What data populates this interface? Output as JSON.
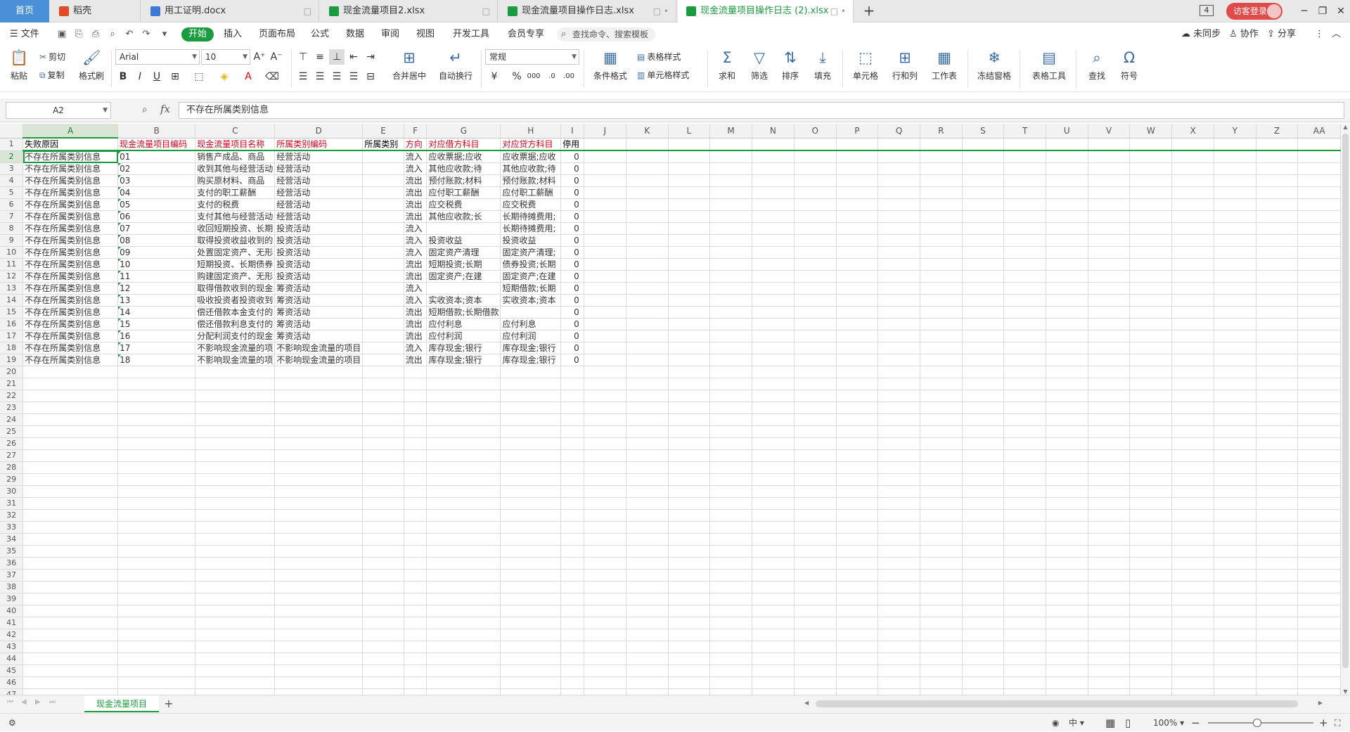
{
  "tabbar": {
    "home": "首页",
    "tabs": [
      {
        "label": "稻壳",
        "icon": "docer-icon",
        "color": "#e04a2a",
        "action": ""
      },
      {
        "label": "用工证明.docx",
        "icon": "word-doc-icon",
        "color": "#3b7bd5",
        "action": "□"
      },
      {
        "label": "现金流量项目2.xlsx",
        "icon": "sheet-doc-icon",
        "color": "#1a9b3f",
        "action": "□"
      },
      {
        "label": "现金流量项目操作日志.xlsx",
        "icon": "sheet-doc-icon",
        "color": "#1a9b3f",
        "action": "□ •"
      },
      {
        "label": "现金流量项目操作日志 (2).xlsx",
        "icon": "sheet-doc-icon",
        "color": "#1a9b3f",
        "action": "□ •"
      }
    ],
    "new_tab": "+",
    "window_count": "4",
    "visitor_login": "访客登录"
  },
  "menubar": {
    "file": "文件",
    "items": [
      "开始",
      "插入",
      "页面布局",
      "公式",
      "数据",
      "审阅",
      "视图",
      "开发工具",
      "会员专享"
    ],
    "search_placeholder": "查找命令、搜索模板",
    "sync": "未同步",
    "collab": "协作",
    "share": "分享"
  },
  "ribbon": {
    "paste": "粘贴",
    "cut": "剪切",
    "copy": "复制",
    "format_painter": "格式刷",
    "font_name": "Arial",
    "font_size": "10",
    "merge": "合并居中",
    "wrap": "自动换行",
    "number_format": "常规",
    "conditional": "条件格式",
    "table_style": "表格样式",
    "cell_style": "单元格样式",
    "sum": "求和",
    "filter": "筛选",
    "sort": "排序",
    "fill": "填充",
    "cell": "单元格",
    "rowcol": "行和列",
    "worksheet": "工作表",
    "freeze": "冻结窗格",
    "table_tools": "表格工具",
    "find": "查找",
    "symbol": "符号"
  },
  "formula_bar": {
    "cell_ref": "A2",
    "fx": "fx",
    "content": "不存在所属类别信息"
  },
  "columns": [
    "A",
    "B",
    "C",
    "D",
    "E",
    "F",
    "G",
    "H",
    "I",
    "J",
    "K",
    "L",
    "M",
    "N",
    "O",
    "P",
    "Q",
    "R",
    "S",
    "T",
    "U",
    "V",
    "W",
    "X",
    "Y",
    "Z",
    "AA"
  ],
  "header_row": [
    "失败原因",
    "现金流量项目编码",
    "现金流量项目名称",
    "所属类别编码",
    "所属类别",
    "方向",
    "对应借方科目",
    "对应贷方科目",
    "停用"
  ],
  "rows": [
    [
      "不存在所属类别信息",
      "01",
      "销售产成品、商品",
      "经营活动",
      "",
      "流入",
      "应收票据;应收",
      "应收票据;应收",
      "0"
    ],
    [
      "不存在所属类别信息",
      "02",
      "收到其他与经营活动",
      "经营活动",
      "",
      "流入",
      "其他应收款;待",
      "其他应收款;待",
      "0"
    ],
    [
      "不存在所属类别信息",
      "03",
      "购买原材料、商品",
      "经营活动",
      "",
      "流出",
      "预付账款;材料",
      "预付账款;材料",
      "0"
    ],
    [
      "不存在所属类别信息",
      "04",
      "支付的职工薪酬",
      "经营活动",
      "",
      "流出",
      "应付职工薪酬",
      "应付职工薪酬",
      "0"
    ],
    [
      "不存在所属类别信息",
      "05",
      "支付的税费",
      "经营活动",
      "",
      "流出",
      "应交税费",
      "应交税费",
      "0"
    ],
    [
      "不存在所属类别信息",
      "06",
      "支付其他与经营活动",
      "经营活动",
      "",
      "流出",
      "其他应收款;长",
      "长期待摊费用;",
      "0"
    ],
    [
      "不存在所属类别信息",
      "07",
      "收回短期投资、长期",
      "投资活动",
      "",
      "流入",
      "",
      "长期待摊费用;",
      "0"
    ],
    [
      "不存在所属类别信息",
      "08",
      "取得投资收益收到的",
      "投资活动",
      "",
      "流入",
      "投资收益",
      "投资收益",
      "0"
    ],
    [
      "不存在所属类别信息",
      "09",
      "处置固定资产、无形",
      "投资活动",
      "",
      "流入",
      "固定资产清理",
      "固定资产清理;",
      "0"
    ],
    [
      "不存在所属类别信息",
      "10",
      "短期投资、长期债券",
      "投资活动",
      "",
      "流出",
      "短期投资;长期",
      "债券投资;长期",
      "0"
    ],
    [
      "不存在所属类别信息",
      "11",
      "购建固定资产、无形",
      "投资活动",
      "",
      "流出",
      "固定资产;在建",
      "固定资产;在建",
      "0"
    ],
    [
      "不存在所属类别信息",
      "12",
      "取得借款收到的现金",
      "筹资活动",
      "",
      "流入",
      "",
      "短期借款;长期",
      "0"
    ],
    [
      "不存在所属类别信息",
      "13",
      "吸收投资者投资收到",
      "筹资活动",
      "",
      "流入",
      "实收资本;资本",
      "实收资本;资本",
      "0"
    ],
    [
      "不存在所属类别信息",
      "14",
      "偿还借款本金支付的",
      "筹资活动",
      "",
      "流出",
      "短期借款;长期借款",
      "",
      "0"
    ],
    [
      "不存在所属类别信息",
      "15",
      "偿还借款利息支付的",
      "筹资活动",
      "",
      "流出",
      "应付利息",
      "应付利息",
      "0"
    ],
    [
      "不存在所属类别信息",
      "16",
      "分配利润支付的现金",
      "筹资活动",
      "",
      "流出",
      "应付利润",
      "应付利润",
      "0"
    ],
    [
      "不存在所属类别信息",
      "17",
      "不影响现金流量的项",
      "不影响现金流量的项目",
      "",
      "流入",
      "库存现金;银行",
      "库存现金;银行",
      "0"
    ],
    [
      "不存在所属类别信息",
      "18",
      "不影响现金流量的项",
      "不影响现金流量的项目",
      "",
      "流出",
      "库存现金;银行",
      "库存现金;银行",
      "0"
    ]
  ],
  "sheet_tab": "现金流量项目",
  "status": {
    "input_mode": "中",
    "zoom": "100%"
  }
}
